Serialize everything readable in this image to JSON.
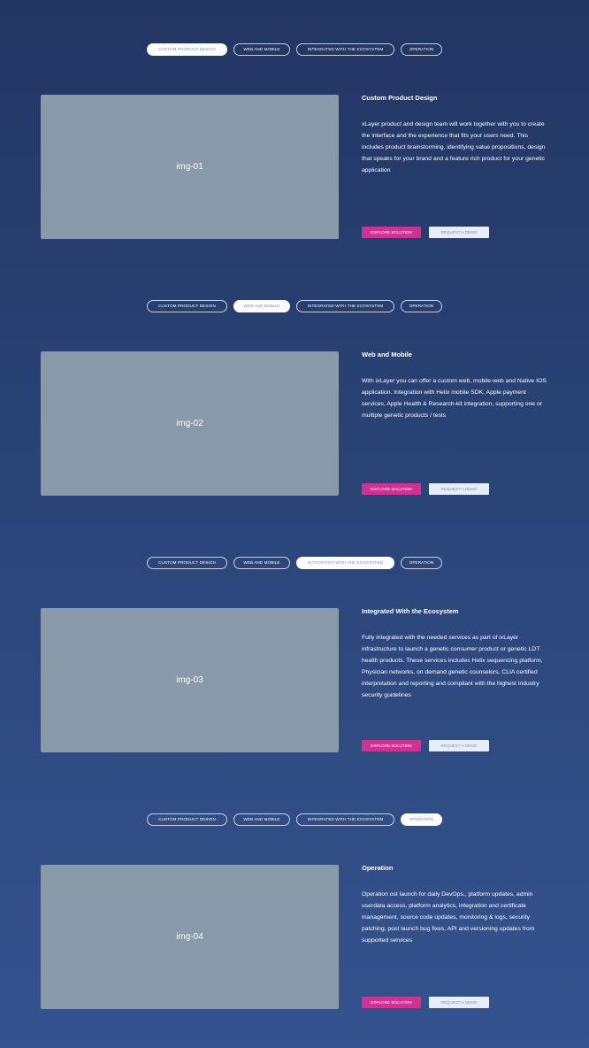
{
  "tabs": [
    "Custom Product Design",
    "Web and Mobile",
    "Integrated With the Ecosystem",
    "Operation"
  ],
  "buttons": {
    "explore": "Explore Solution",
    "demo": "Request a Demo"
  },
  "sections": [
    {
      "active_tab": 0,
      "image_label": "img-01",
      "title": "Custom Product Design",
      "description": "xLayer product and design team will work together with you to create the interface and the experience that fits your users need. This includes product brainstorming, identifying value propositions, design that speaks for your brand and a feature rich product for your genetic application"
    },
    {
      "active_tab": 1,
      "image_label": "img-02",
      "title": "Web and Mobile",
      "description": "With ixLayer you can offer a custom web, mobile-web and Native IOS application. Integration with Helix mobile SDK, Apple payment services, Apple Health & Research-kit integration, supporting one or multiple genetic products / tests"
    },
    {
      "active_tab": 2,
      "image_label": "img-03",
      "title": "Integrated With the Ecosystem",
      "description": "Fully integrated with the needed services as part of ixLayer infrastructure to launch a genetic consumer product or genetic LDT health products. These services includes Helix sequencing platform, Physician networks, on demand genetic counselors, CLIA certified interpretation and reporting and compliant with the highest industry security guidelines"
    },
    {
      "active_tab": 3,
      "image_label": "img-04",
      "title": "Operation",
      "description": "Operation ost launch for daily DevOps., platform updates, admin userdata access, platform analytics, integration and certificate management, source code updates, monitoring & logs, security patching, post launch bug fixes, API and versioning updates from supported services"
    }
  ]
}
